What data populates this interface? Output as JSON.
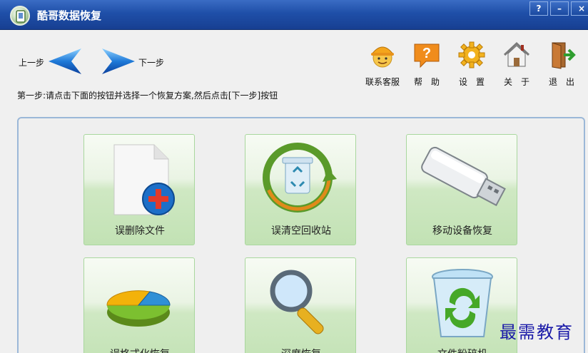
{
  "window": {
    "title": "酷哥数据恢复"
  },
  "title_buttons": {
    "help": "?",
    "minimize": "–",
    "close": "×"
  },
  "nav": {
    "prev_label": "上一步",
    "next_label": "下一步"
  },
  "toolbar": {
    "items": [
      {
        "label": "联系客服",
        "icon": "support-agent-icon"
      },
      {
        "label": "帮　助",
        "icon": "help-icon"
      },
      {
        "label": "设　置",
        "icon": "gear-icon"
      },
      {
        "label": "关　于",
        "icon": "home-icon"
      },
      {
        "label": "退　出",
        "icon": "exit-door-icon"
      }
    ]
  },
  "instruction": "第一步:请点击下面的按钮并选择一个恢复方案,然后点击[下一步]按钮",
  "cards": [
    {
      "label": "误删除文件",
      "icon": "document-add-icon"
    },
    {
      "label": "误清空回收站",
      "icon": "recycle-bin-refresh-icon"
    },
    {
      "label": "移动设备恢复",
      "icon": "usb-drive-icon"
    },
    {
      "label": "误格式化恢复",
      "icon": "pie-chart-icon"
    },
    {
      "label": "深度恢复",
      "icon": "magnifier-icon"
    },
    {
      "label": "文件粉碎机",
      "icon": "recycle-bin-icon"
    }
  ],
  "watermark": "最需教育"
}
